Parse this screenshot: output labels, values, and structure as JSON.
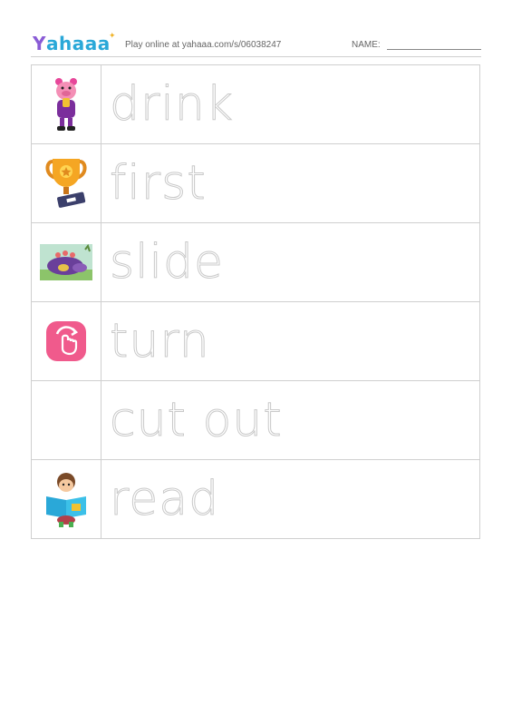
{
  "header": {
    "logo_y": "Y",
    "logo_rest": "ahaaa",
    "play_online": "Play online at yahaaa.com/s/06038247",
    "name_label": "NAME:"
  },
  "rows": [
    {
      "word": "drink",
      "icon": "pig-drinking-icon"
    },
    {
      "word": "first",
      "icon": "trophy-icon"
    },
    {
      "word": "slide",
      "icon": "animal-sliding-icon"
    },
    {
      "word": "turn",
      "icon": "turn-gesture-icon"
    },
    {
      "word": "cut out",
      "icon": ""
    },
    {
      "word": "read",
      "icon": "child-reading-icon"
    }
  ],
  "colors": {
    "grid_line": "#cfcfcf",
    "trace_text": "#c9c9c9",
    "logo_purple": "#8a5cd6",
    "logo_blue": "#2aa8d8"
  }
}
